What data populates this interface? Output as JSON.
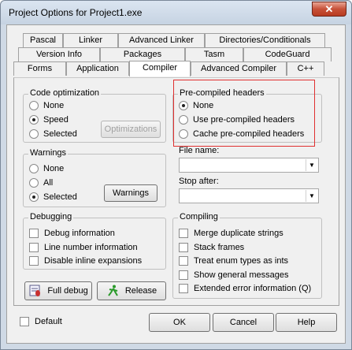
{
  "window": {
    "title": "Project Options for Project1.exe",
    "close_glyph": "✕"
  },
  "tabs": {
    "row1": [
      "Pascal",
      "Linker",
      "Advanced Linker",
      "Directories/Conditionals"
    ],
    "row2": [
      "Version Info",
      "Packages",
      "Tasm",
      "CodeGuard"
    ],
    "row3": [
      "Forms",
      "Application",
      "Compiler",
      "Advanced Compiler",
      "C++"
    ],
    "active": "Compiler"
  },
  "code_optimization": {
    "title": "Code optimization",
    "options": [
      "None",
      "Speed",
      "Selected"
    ],
    "selected": "Speed",
    "button": "Optimizations"
  },
  "precompiled_headers": {
    "title": "Pre-compiled headers",
    "options": [
      "None",
      "Use pre-compiled headers",
      "Cache pre-compiled headers"
    ],
    "selected": "None",
    "file_name_label": "File name:",
    "file_name_value": "",
    "stop_after_label": "Stop after:",
    "stop_after_value": ""
  },
  "warnings": {
    "title": "Warnings",
    "options": [
      "None",
      "All",
      "Selected"
    ],
    "selected": "Selected",
    "button": "Warnings"
  },
  "debugging": {
    "title": "Debugging",
    "items": [
      "Debug information",
      "Line number information",
      "Disable inline expansions"
    ]
  },
  "compiling": {
    "title": "Compiling",
    "items": [
      "Merge duplicate strings",
      "Stack frames",
      "Treat enum types as ints",
      "Show general messages",
      "Extended error information (Q)"
    ]
  },
  "buttons": {
    "full_debug": "Full debug",
    "release": "Release",
    "ok": "OK",
    "cancel": "Cancel",
    "help": "Help"
  },
  "default_checkbox": "Default",
  "colors": {
    "highlight": "#e03030",
    "titlebar": "#cfd9e5",
    "close": "#c75138"
  }
}
